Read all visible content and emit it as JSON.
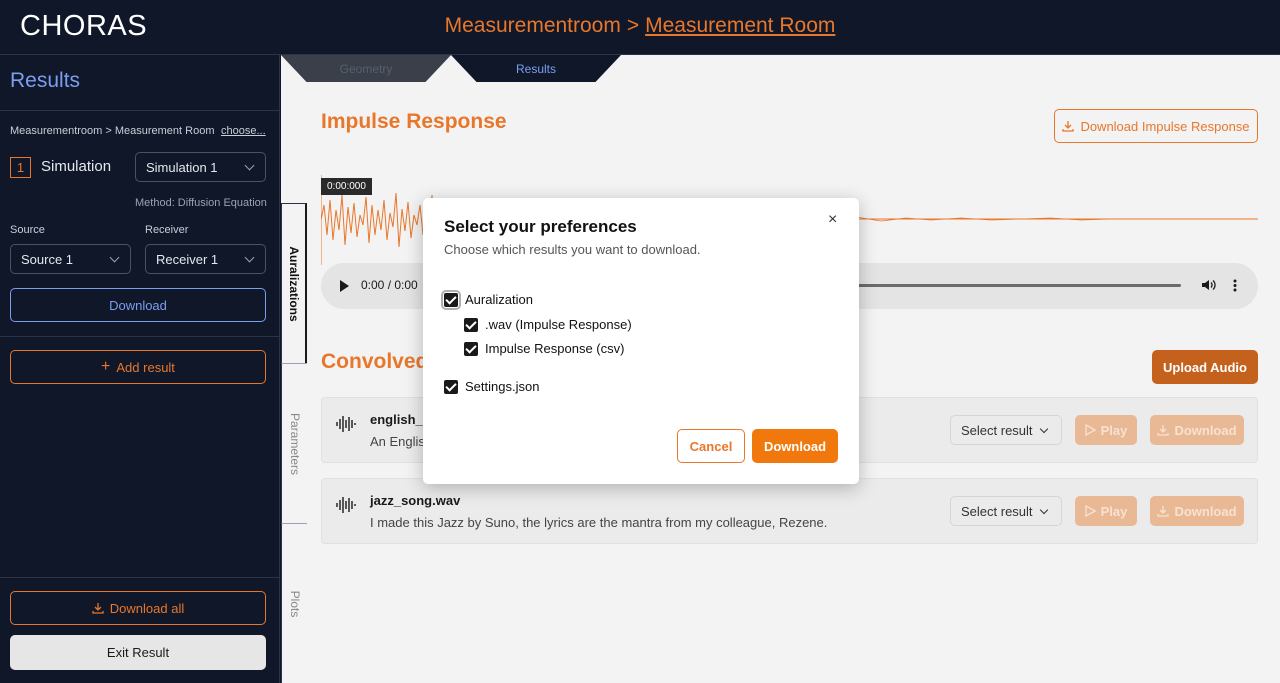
{
  "header": {
    "logo": "CHORAS",
    "breadcrumb_project": "Measurementroom",
    "breadcrumb_separator": ">",
    "breadcrumb_room": "Measurement Room"
  },
  "sidebar": {
    "title": "Results",
    "path": "Measurementroom > Measurement Room",
    "choose_link": "choose...",
    "index_badge": "1",
    "simulation_label": "Simulation",
    "simulation_select": "Simulation 1",
    "method": "Method: Diffusion Equation",
    "source_label": "Source",
    "source_select": "Source 1",
    "receiver_label": "Receiver",
    "receiver_select": "Receiver 1",
    "download_button": "Download",
    "add_result_button": "Add result",
    "download_all_button": "Download all",
    "exit_button": "Exit Result"
  },
  "tabs": {
    "geometry": "Geometry",
    "results": "Results"
  },
  "side_tabs": {
    "auralizations": "Auralizations",
    "parameters": "Parameters",
    "plots": "Plots"
  },
  "main": {
    "impulse_title": "Impulse Response",
    "download_ir_button": "Download Impulse Response",
    "time_badge": "0:00:000",
    "audio_time": "0:00 / 0:00",
    "convolved_title": "Convolved",
    "upload_button": "Upload Audio",
    "audio_items": [
      {
        "name": "english_s",
        "description": "An English",
        "select_label": "Select result",
        "play_label": "Play",
        "download_label": "Download"
      },
      {
        "name": "jazz_song.wav",
        "description": "I made this Jazz by Suno, the lyrics are the mantra from my colleague, Rezene.",
        "select_label": "Select result",
        "play_label": "Play",
        "download_label": "Download"
      }
    ]
  },
  "modal": {
    "title": "Select your preferences",
    "subtitle": "Choose which results you want to download.",
    "close_icon": "×",
    "options": {
      "auralization": "Auralization",
      "wav": ".wav (Impulse Response)",
      "csv": "Impulse Response (csv)",
      "settings": "Settings.json"
    },
    "checked": {
      "auralization": true,
      "wav": true,
      "csv": true,
      "settings": true
    },
    "cancel_button": "Cancel",
    "download_button": "Download"
  },
  "colors": {
    "accent_orange": "#e8772b",
    "accent_blue": "#7b9ef0",
    "background_dark": "#0f1729"
  }
}
